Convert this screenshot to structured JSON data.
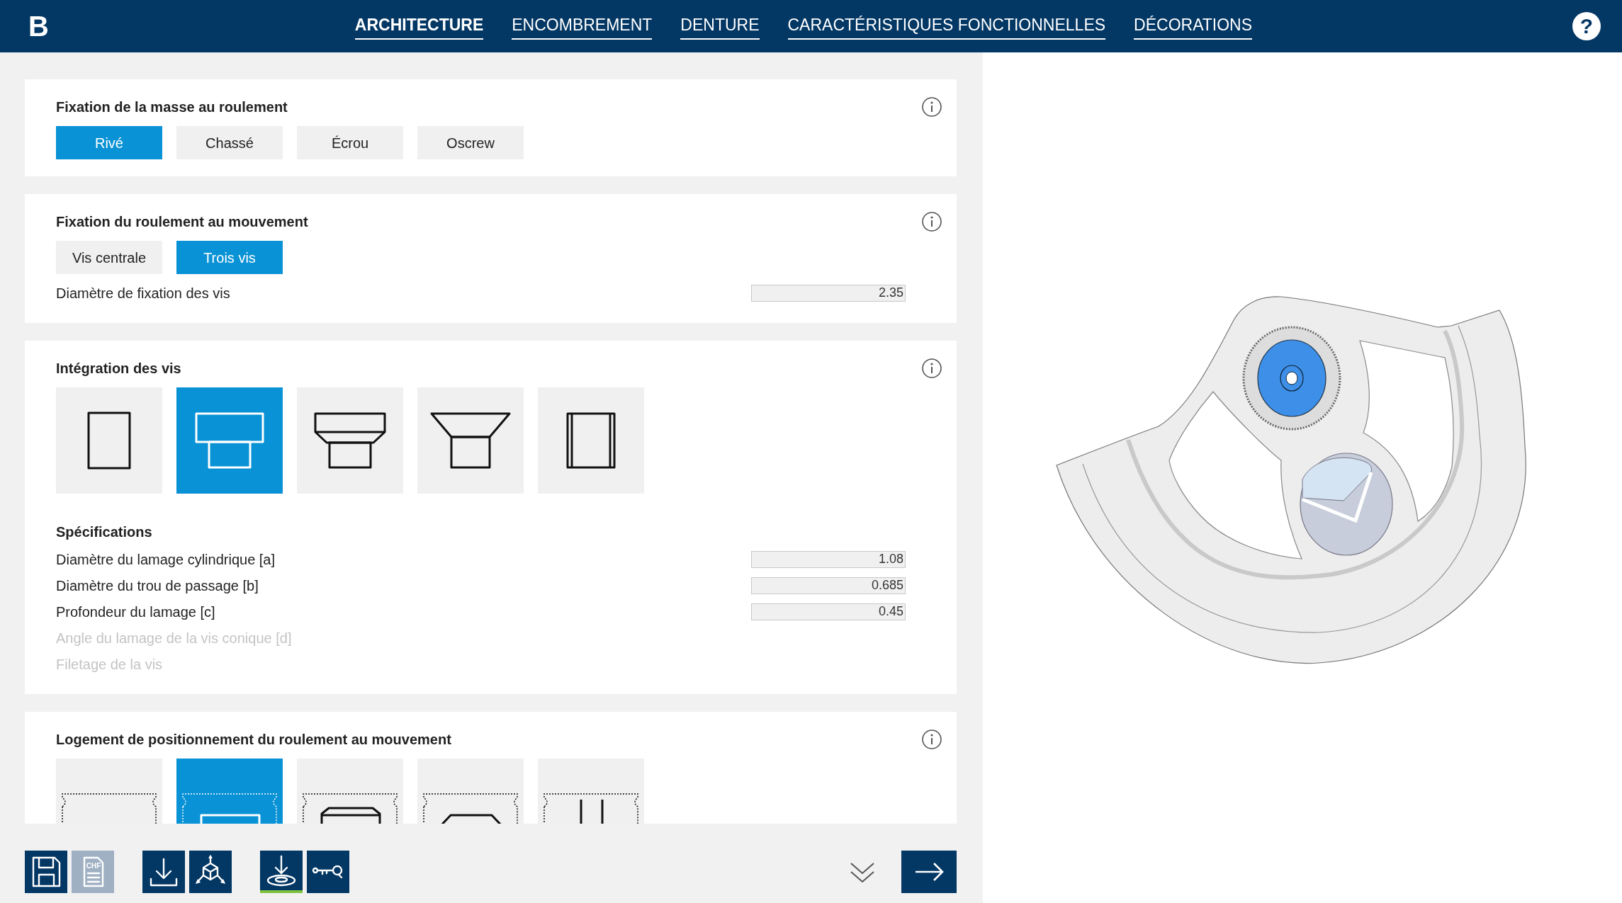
{
  "brand": "B",
  "nav": [
    {
      "label": "ARCHITECTURE",
      "selected": true
    },
    {
      "label": "ENCOMBREMENT",
      "selected": false
    },
    {
      "label": "DENTURE",
      "selected": false
    },
    {
      "label": "CARACTÉRISTIQUES FONCTIONNELLES",
      "selected": false
    },
    {
      "label": "DÉCORATIONS",
      "selected": false
    }
  ],
  "help": "?",
  "sections": [
    {
      "title": "Fixation de la masse au roulement",
      "kind": "options",
      "options": [
        {
          "label": "Rivé",
          "selected": true
        },
        {
          "label": "Chassé",
          "selected": false
        },
        {
          "label": "Écrou",
          "selected": false
        },
        {
          "label": "Oscrew",
          "selected": false
        }
      ]
    },
    {
      "title": "Fixation du roulement au mouvement",
      "kind": "options",
      "options": [
        {
          "label": "Vis centrale",
          "selected": false
        },
        {
          "label": "Trois vis",
          "selected": true
        }
      ],
      "fields": [
        {
          "label": "Diamètre de fixation des vis",
          "value": "2.35",
          "disabled": false
        }
      ]
    },
    {
      "title": "Intégration des vis",
      "kind": "tiles",
      "tiles": [
        {
          "kind": "plain",
          "selected": false
        },
        {
          "kind": "counterbore",
          "selected": true
        },
        {
          "kind": "chamfered",
          "selected": false
        },
        {
          "kind": "countersunk",
          "selected": false
        },
        {
          "kind": "sleeve",
          "selected": false
        }
      ],
      "subtitle": "Spécifications",
      "fields": [
        {
          "label": "Diamètre du lamage cylindrique [a]",
          "value": "1.08",
          "disabled": false
        },
        {
          "label": "Diamètre du trou de passage [b]",
          "value": "0.685",
          "disabled": false
        },
        {
          "label": "Profondeur du lamage [c]",
          "value": "0.45",
          "disabled": false
        },
        {
          "label": "Angle du lamage de la vis conique [d]",
          "disabled": true
        },
        {
          "label": "Filetage de la vis",
          "disabled": true
        }
      ]
    },
    {
      "title": "Logement de positionnement du roulement au mouvement",
      "kind": "tiles",
      "tiles": [
        {
          "kind": "seatflat",
          "selected": false
        },
        {
          "kind": "seatblock",
          "selected": true
        },
        {
          "kind": "seatchamfer",
          "selected": false
        },
        {
          "kind": "seatcone",
          "selected": false
        },
        {
          "kind": "seatpins",
          "selected": false
        }
      ]
    }
  ],
  "toolbar": [
    {
      "kind": "save",
      "disabled": false,
      "active": false
    },
    {
      "kind": "quote",
      "label": "CHF",
      "disabled": true,
      "active": false
    },
    {
      "kind": "download",
      "disabled": false,
      "active": false
    },
    {
      "kind": "axes",
      "disabled": false,
      "active": false
    },
    {
      "kind": "install",
      "disabled": false,
      "active": true
    },
    {
      "kind": "key",
      "disabled": false,
      "active": false
    }
  ]
}
